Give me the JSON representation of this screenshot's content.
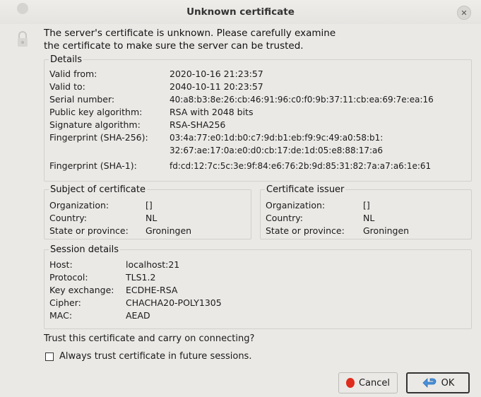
{
  "window": {
    "title": "Unknown certificate"
  },
  "intro": {
    "line1": "The server's certificate is unknown. Please carefully examine",
    "line2": "the certificate to make sure the server can be trusted."
  },
  "details": {
    "legend": "Details",
    "rows": [
      {
        "label": "Valid from:",
        "value": "2020-10-16 21:23:57"
      },
      {
        "label": "Valid to:",
        "value": "2040-10-11 20:23:57"
      },
      {
        "label": "Serial number:",
        "value": "40:a8:b3:8e:26:cb:46:91:96:c0:f0:9b:37:11:cb:ea:69:7e:ea:16"
      },
      {
        "label": "Public key algorithm:",
        "value": "RSA with 2048 bits"
      },
      {
        "label": "Signature algorithm:",
        "value": "RSA-SHA256"
      },
      {
        "label": "Fingerprint (SHA-256):",
        "value": "03:4a:77:e0:1d:b0:c7:9d:b1:eb:f9:9c:49:a0:58:b1:",
        "value2": "32:67:ae:17:0a:e0:d0:cb:17:de:1d:05:e8:88:17:a6"
      },
      {
        "label": "Fingerprint (SHA-1):",
        "value": "fd:cd:12:7c:5c:3e:9f:84:e6:76:2b:9d:85:31:82:7a:a7:a6:1e:61"
      }
    ]
  },
  "subject": {
    "legend": "Subject of certificate",
    "rows": [
      {
        "label": "Organization:",
        "value": "[]"
      },
      {
        "label": "Country:",
        "value": "NL"
      },
      {
        "label": "State or province:",
        "value": "Groningen"
      }
    ]
  },
  "issuer": {
    "legend": "Certificate issuer",
    "rows": [
      {
        "label": "Organization:",
        "value": "[]"
      },
      {
        "label": "Country:",
        "value": "NL"
      },
      {
        "label": "State or province:",
        "value": "Groningen"
      }
    ]
  },
  "session": {
    "legend": "Session details",
    "rows": [
      {
        "label": "Host:",
        "value": "localhost:21"
      },
      {
        "label": "Protocol:",
        "value": "TLS1.2"
      },
      {
        "label": "Key exchange:",
        "value": "ECDHE-RSA"
      },
      {
        "label": "Cipher:",
        "value": "CHACHA20-POLY1305"
      },
      {
        "label": "MAC:",
        "value": "AEAD"
      }
    ]
  },
  "question": "Trust this certificate and carry on connecting?",
  "always_trust": {
    "label": "Always trust certificate in future sessions.",
    "checked": false
  },
  "buttons": {
    "cancel": "Cancel",
    "ok": "OK"
  },
  "colors": {
    "cancel_icon": "#e02c1c",
    "ok_icon": "#4a90d9"
  }
}
